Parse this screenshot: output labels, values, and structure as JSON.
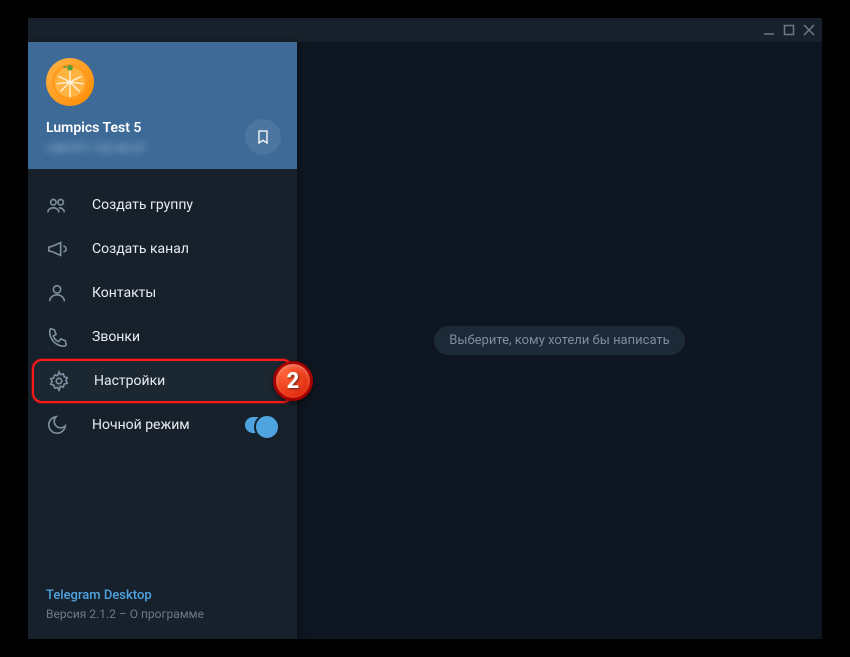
{
  "window": {
    "minimize": "_",
    "maximize": "□",
    "close": "×"
  },
  "profile": {
    "name": "Lumpics Test 5",
    "subtitle": "+38 071 123 45 67"
  },
  "menu": {
    "items": [
      {
        "label": "Создать группу"
      },
      {
        "label": "Создать канал"
      },
      {
        "label": "Контакты"
      },
      {
        "label": "Звонки"
      },
      {
        "label": "Настройки"
      },
      {
        "label": "Ночной режим"
      }
    ]
  },
  "step_badge": "2",
  "footer": {
    "title": "Telegram Desktop",
    "version": "Версия 2.1.2 – О программе"
  },
  "main": {
    "empty_hint": "Выберите, кому хотели бы написать"
  }
}
